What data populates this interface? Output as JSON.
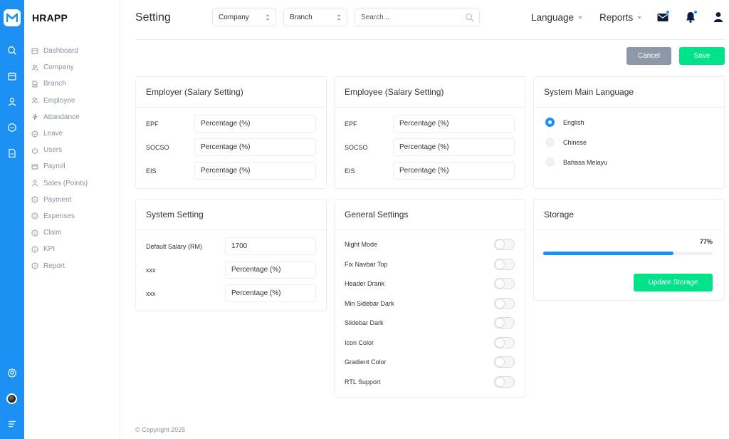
{
  "app": {
    "brand": "HRAPP",
    "page_title": "Setting"
  },
  "colors": {
    "primary": "#1c8ff2",
    "success": "#00e38a",
    "cancel": "#8c97a7"
  },
  "rail_icons": [
    "logo-icon",
    "search-icon",
    "calendar-icon",
    "user-icon",
    "chat-icon",
    "document-icon",
    "settings-icon",
    "avatar",
    "menu-icon"
  ],
  "sidebar": {
    "items": [
      {
        "label": "Dashboard",
        "icon": "dashboard-icon"
      },
      {
        "label": "Company",
        "icon": "company-icon"
      },
      {
        "label": "Branch",
        "icon": "branch-icon"
      },
      {
        "label": "Employee",
        "icon": "employee-icon"
      },
      {
        "label": "Attandance",
        "icon": "bolt-icon"
      },
      {
        "label": "Leave",
        "icon": "check-circle-icon"
      },
      {
        "label": "Users",
        "icon": "power-icon"
      },
      {
        "label": "Payroll",
        "icon": "card-icon"
      },
      {
        "label": "Sales (Points)",
        "icon": "person-icon"
      },
      {
        "label": "Payment",
        "icon": "info-icon"
      },
      {
        "label": "Expenses",
        "icon": "info-icon"
      },
      {
        "label": "Claim",
        "icon": "info-icon"
      },
      {
        "label": "KPI",
        "icon": "info-icon"
      },
      {
        "label": "Report",
        "icon": "info-icon"
      }
    ]
  },
  "header": {
    "company_select": "Company",
    "branch_select": "Branch",
    "search_placeholder": "Search...",
    "language_menu": "Language",
    "reports_menu": "Reports"
  },
  "actions": {
    "cancel": "Cancel",
    "save": "Save"
  },
  "employer": {
    "title": "Employer (Salary Setting)",
    "rows": [
      {
        "label": "EPF",
        "value": "Percentage (%)"
      },
      {
        "label": "SOCSO",
        "value": "Percentage (%)"
      },
      {
        "label": "EIS",
        "value": "Percentage (%)"
      }
    ]
  },
  "employee": {
    "title": "Employee (Salary Setting)",
    "rows": [
      {
        "label": "EPF",
        "value": "Percentage (%)"
      },
      {
        "label": "SOCSO",
        "value": "Percentage (%)"
      },
      {
        "label": "EIS",
        "value": "Percentage (%)"
      }
    ]
  },
  "language": {
    "title": "System Main Language",
    "options": [
      {
        "label": "English",
        "selected": true
      },
      {
        "label": "Chinese",
        "selected": false
      },
      {
        "label": "Bahasa Melayu",
        "selected": false
      }
    ]
  },
  "system": {
    "title": "System Setting",
    "rows": [
      {
        "label": "Default Salary (RM)",
        "value": "1700"
      },
      {
        "label": "xxx",
        "value": "Percentage (%)"
      },
      {
        "label": "xxx",
        "value": "Percentage (%)"
      }
    ]
  },
  "general": {
    "title": "General Settings",
    "toggles": [
      {
        "label": "Night Mode",
        "on": false
      },
      {
        "label": "Fix Navbar Top",
        "on": false
      },
      {
        "label": "Header Drank",
        "on": false
      },
      {
        "label": "Min Sidebar Dark",
        "on": false
      },
      {
        "label": "Slidebar Dark",
        "on": false
      },
      {
        "label": "Icon Color",
        "on": false
      },
      {
        "label": "Gradient Color",
        "on": false
      },
      {
        "label": "RTL Support",
        "on": false
      }
    ]
  },
  "storage": {
    "title": "Storage",
    "percent_label": "77%",
    "percent": 77,
    "button": "Update Storage"
  },
  "footer": {
    "copyright": "© Copyright 2025"
  }
}
